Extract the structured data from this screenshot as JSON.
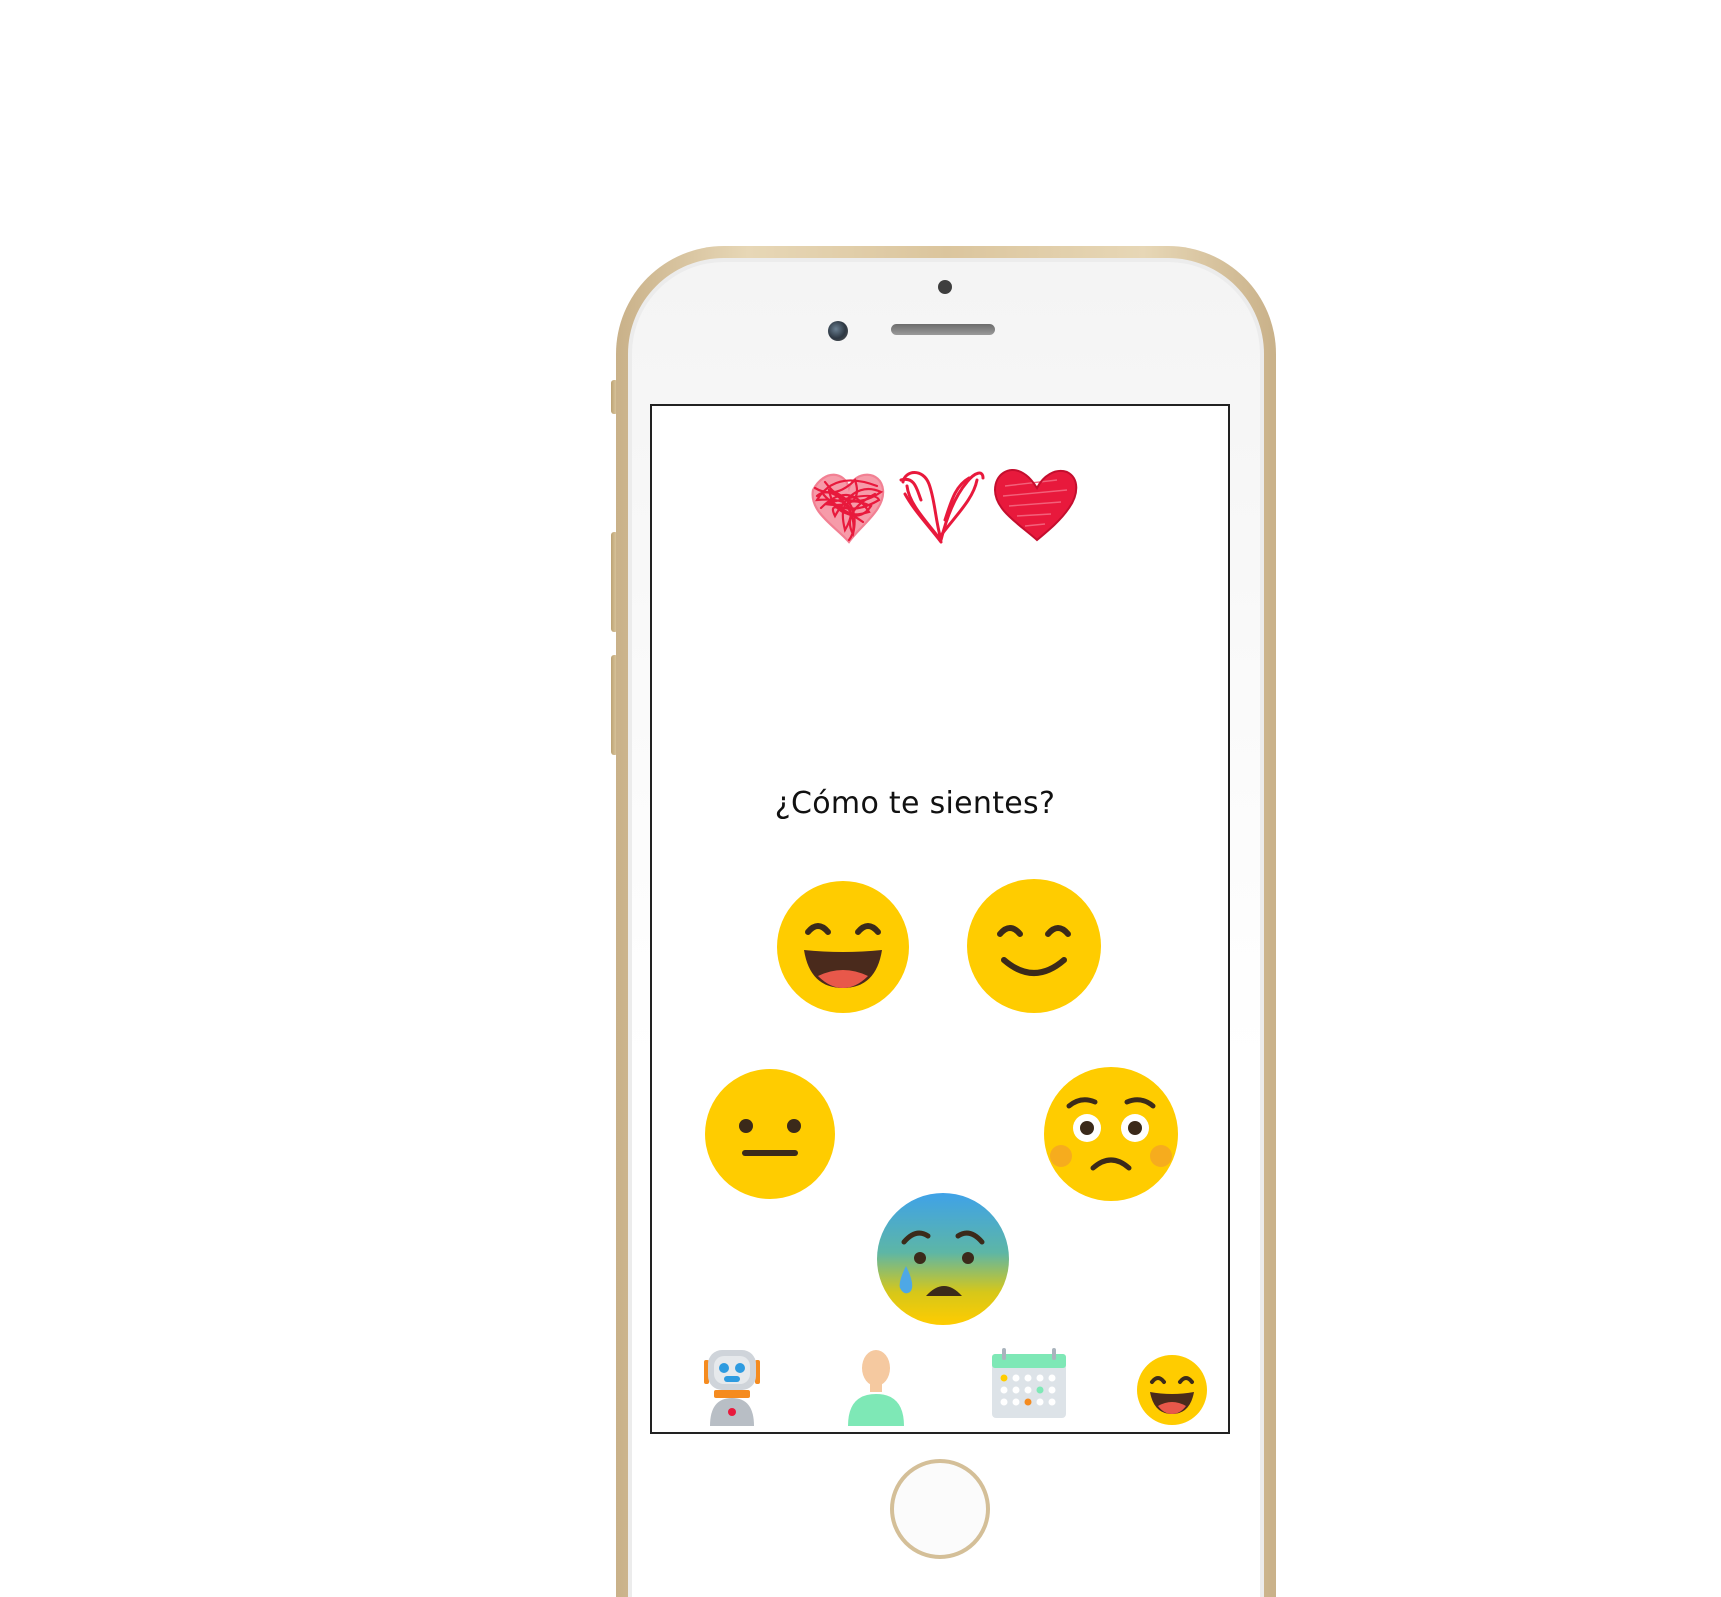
{
  "screen": {
    "question": "¿Cómo te sientes?"
  },
  "moods": [
    {
      "name": "very-happy",
      "icon": "laughing-face-icon"
    },
    {
      "name": "happy",
      "icon": "smiling-face-icon"
    },
    {
      "name": "neutral",
      "icon": "neutral-face-icon"
    },
    {
      "name": "worried",
      "icon": "worried-face-icon"
    },
    {
      "name": "anxious",
      "icon": "anxious-sweat-face-icon"
    }
  ],
  "bottom_nav": [
    {
      "icon": "robot-icon"
    },
    {
      "icon": "user-profile-icon"
    },
    {
      "icon": "calendar-icon"
    },
    {
      "icon": "mood-emoji-icon"
    }
  ],
  "colors": {
    "emoji_yellow": "#FFCC00",
    "heart_red": "#E8193C",
    "phone_gold": "#D9C59E",
    "robot_orange": "#F58B1F",
    "calendar_green": "#7EE8B6"
  }
}
